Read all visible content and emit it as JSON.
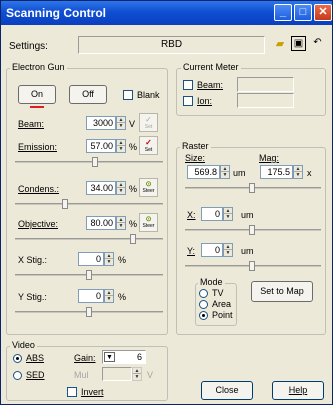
{
  "window": {
    "title": "Scanning Control"
  },
  "settings": {
    "label": "Settings:",
    "value": "RBD"
  },
  "electron_gun": {
    "title": "Electron Gun",
    "on_label": "On",
    "off_label": "Off",
    "blank_label": "Blank",
    "beam": {
      "label": "Beam:",
      "value": "3000",
      "unit": "V",
      "btn": "Set"
    },
    "emission": {
      "label": "Emission:",
      "value": "57.00",
      "unit": "%",
      "btn": "Set"
    },
    "condens": {
      "label": "Condens.:",
      "value": "34.00",
      "unit": "%",
      "btn": "Steer"
    },
    "objective": {
      "label": "Objective:",
      "value": "80.00",
      "unit": "%",
      "btn": "Steer"
    },
    "xstig": {
      "label": "X Stig.:",
      "value": "0",
      "unit": "%"
    },
    "ystig": {
      "label": "Y Stig.:",
      "value": "0",
      "unit": "%"
    }
  },
  "current_meter": {
    "title": "Current Meter",
    "beam_label": "Beam:",
    "ion_label": "Ion:"
  },
  "raster": {
    "title": "Raster",
    "size_label": "Size:",
    "size_value": "569.8",
    "size_unit": "um",
    "mag_label": "Mag:",
    "mag_value": "175.5",
    "mag_unit": "x",
    "x_label": "X:",
    "x_value": "0",
    "x_unit": "um",
    "y_label": "Y:",
    "y_value": "0",
    "y_unit": "um",
    "mode_title": "Mode",
    "modes": [
      "TV",
      "Area",
      "Point"
    ],
    "selected_mode": "Point",
    "set_to_map": "Set to Map"
  },
  "video": {
    "title": "Video",
    "abs_label": "ABS",
    "gain_label": "Gain:",
    "gain_value": "6",
    "sed_label": "SED",
    "mul_label": "Mul",
    "mul_unit": "V",
    "invert_label": "Invert"
  },
  "buttons": {
    "close": "Close",
    "help": "Help"
  }
}
